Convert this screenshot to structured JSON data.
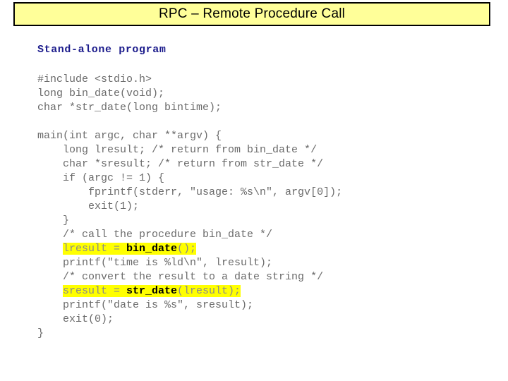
{
  "slide": {
    "title": "RPC – Remote Procedure Call",
    "title_bg": "#ffff99",
    "title_border": "#000000",
    "heading": "Stand-alone program",
    "heading_color": "#1c1c8c",
    "code_color": "#6b6b6b",
    "highlight_color": "#ffff00"
  },
  "code": {
    "lines": [
      {
        "id": "l01",
        "text": "#include <stdio.h>"
      },
      {
        "id": "l02",
        "text": "long bin_date(void);"
      },
      {
        "id": "l03",
        "text": "char *str_date(long bintime);"
      },
      {
        "id": "l04",
        "text": ""
      },
      {
        "id": "l05",
        "text": "main(int argc, char **argv) {"
      },
      {
        "id": "l06",
        "text": "    long lresult; /* return from bin_date */"
      },
      {
        "id": "l07",
        "text": "    char *sresult; /* return from str_date */"
      },
      {
        "id": "l08",
        "text": "    if (argc != 1) {"
      },
      {
        "id": "l09",
        "text": "        fprintf(stderr, \"usage: %s\\n\", argv[0]);"
      },
      {
        "id": "l10",
        "text": "        exit(1);"
      },
      {
        "id": "l11",
        "text": "    }"
      },
      {
        "id": "l12",
        "text": "    /* call the procedure bin_date */"
      },
      {
        "id": "l13",
        "highlighted": true,
        "indent": "    ",
        "parts": [
          {
            "kind": "plain",
            "text": "lresult = "
          },
          {
            "kind": "fn",
            "text": "bin_date"
          },
          {
            "kind": "plain",
            "text": "();"
          }
        ],
        "text": "    lresult = bin_date();"
      },
      {
        "id": "l14",
        "text": "    printf(\"time is %ld\\n\", lresult);"
      },
      {
        "id": "l15",
        "text": "    /* convert the result to a date string */"
      },
      {
        "id": "l16",
        "highlighted": true,
        "indent": "    ",
        "parts": [
          {
            "kind": "plain",
            "text": "sresult = "
          },
          {
            "kind": "fn",
            "text": "str_date"
          },
          {
            "kind": "plain",
            "text": "(lresult);"
          }
        ],
        "text": "    sresult = str_date(lresult);"
      },
      {
        "id": "l17",
        "text": "    printf(\"date is %s\", sresult);"
      },
      {
        "id": "l18",
        "text": "    exit(0);"
      },
      {
        "id": "l19",
        "text": "}"
      }
    ]
  }
}
